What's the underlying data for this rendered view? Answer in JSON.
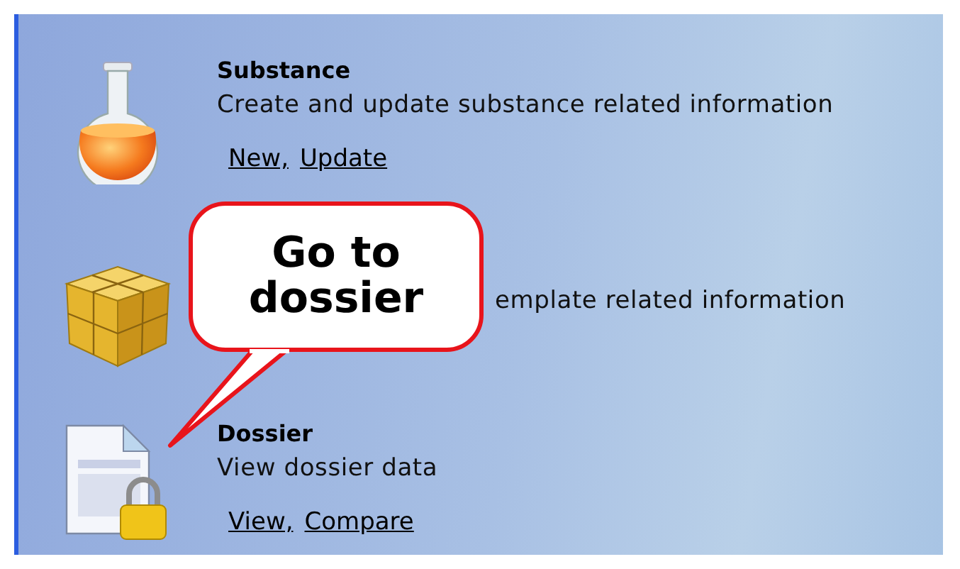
{
  "items": [
    {
      "kind": "substance",
      "title": "Substance",
      "description": "Create and update substance related information",
      "links": [
        "New,",
        "Update"
      ]
    },
    {
      "kind": "template",
      "description": "emplate related information"
    },
    {
      "kind": "dossier",
      "title": "Dossier",
      "description": "View dossier data",
      "links": [
        "View,",
        "Compare"
      ]
    }
  ],
  "callout": {
    "text": "Go to dossier"
  }
}
